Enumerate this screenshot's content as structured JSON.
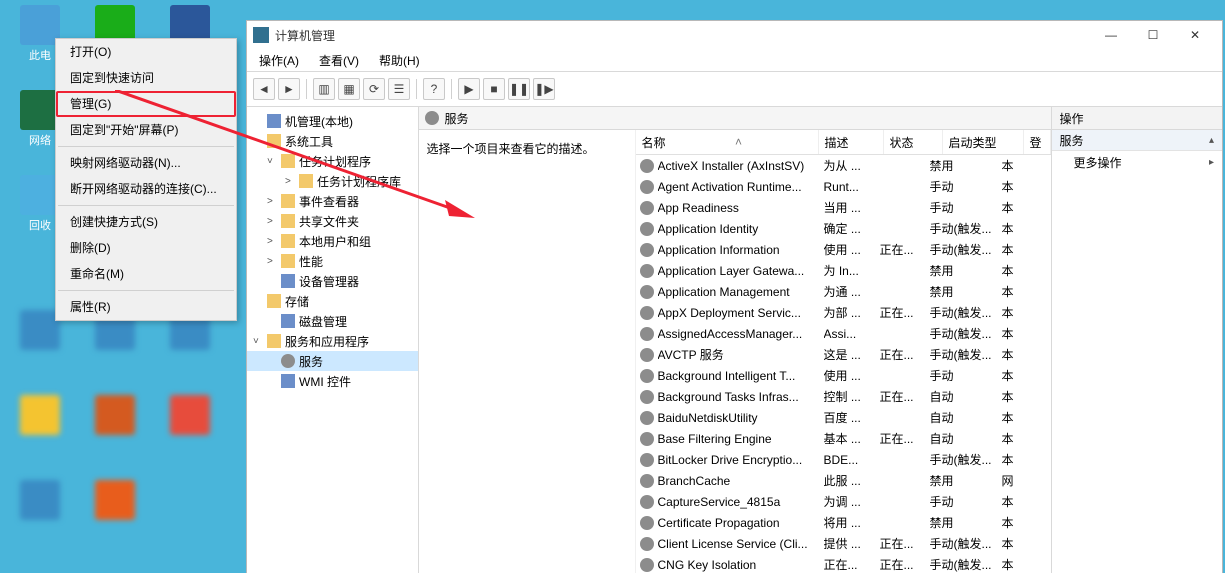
{
  "desktop": {
    "pc": "此电",
    "net": "网络",
    "bin": "回收"
  },
  "context_menu": {
    "open": "打开(O)",
    "pin_quick": "固定到快速访问",
    "manage": "管理(G)",
    "pin_start": "固定到\"开始\"屏幕(P)",
    "map_drive": "映射网络驱动器(N)...",
    "disconnect_drive": "断开网络驱动器的连接(C)...",
    "create_shortcut": "创建快捷方式(S)",
    "delete": "删除(D)",
    "rename": "重命名(M)",
    "properties": "属性(R)"
  },
  "window": {
    "title": "计算机管理",
    "min_glyph": "—",
    "max_glyph": "☐",
    "close_glyph": "✕"
  },
  "menubar": {
    "action": "操作(A)",
    "view": "查看(V)",
    "help": "帮助(H)"
  },
  "tree": {
    "root": "机管理(本地)",
    "sys_tools": "系统工具",
    "task_sched": "任务计划程序",
    "task_sched_lib": "任务计划程序库",
    "event_viewer": "事件查看器",
    "shared": "共享文件夹",
    "users": "本地用户和组",
    "perf": "性能",
    "devmgr": "设备管理器",
    "storage": "存储",
    "diskmgmt": "磁盘管理",
    "services_apps": "服务和应用程序",
    "services": "服务",
    "wmi": "WMI 控件"
  },
  "center": {
    "tab_label": "服务",
    "desc_prompt": "选择一个项目来查看它的描述。"
  },
  "columns": {
    "name": "名称",
    "desc": "描述",
    "status": "状态",
    "start": "启动类型",
    "logon": "登"
  },
  "sort_glyph": "˄",
  "services": [
    {
      "name": "ActiveX Installer (AxInstSV)",
      "desc": "为从 ...",
      "status": "",
      "start": "禁用",
      "logon": "本"
    },
    {
      "name": "Agent Activation Runtime...",
      "desc": "Runt...",
      "status": "",
      "start": "手动",
      "logon": "本"
    },
    {
      "name": "App Readiness",
      "desc": "当用 ...",
      "status": "",
      "start": "手动",
      "logon": "本"
    },
    {
      "name": "Application Identity",
      "desc": "确定 ...",
      "status": "",
      "start": "手动(触发...",
      "logon": "本"
    },
    {
      "name": "Application Information",
      "desc": "使用 ...",
      "status": "正在...",
      "start": "手动(触发...",
      "logon": "本"
    },
    {
      "name": "Application Layer Gatewa...",
      "desc": "为 In...",
      "status": "",
      "start": "禁用",
      "logon": "本"
    },
    {
      "name": "Application Management",
      "desc": "为通 ...",
      "status": "",
      "start": "禁用",
      "logon": "本"
    },
    {
      "name": "AppX Deployment Servic...",
      "desc": "为部 ...",
      "status": "正在...",
      "start": "手动(触发...",
      "logon": "本"
    },
    {
      "name": "AssignedAccessManager...",
      "desc": "Assi...",
      "status": "",
      "start": "手动(触发...",
      "logon": "本"
    },
    {
      "name": "AVCTP 服务",
      "desc": "这是 ...",
      "status": "正在...",
      "start": "手动(触发...",
      "logon": "本"
    },
    {
      "name": "Background Intelligent T...",
      "desc": "使用 ...",
      "status": "",
      "start": "手动",
      "logon": "本"
    },
    {
      "name": "Background Tasks Infras...",
      "desc": "控制 ...",
      "status": "正在...",
      "start": "自动",
      "logon": "本"
    },
    {
      "name": "BaiduNetdiskUtility",
      "desc": "百度 ...",
      "status": "",
      "start": "自动",
      "logon": "本"
    },
    {
      "name": "Base Filtering Engine",
      "desc": "基本 ...",
      "status": "正在...",
      "start": "自动",
      "logon": "本"
    },
    {
      "name": "BitLocker Drive Encryptio...",
      "desc": "BDE...",
      "status": "",
      "start": "手动(触发...",
      "logon": "本"
    },
    {
      "name": "BranchCache",
      "desc": "此服 ...",
      "status": "",
      "start": "禁用",
      "logon": "网"
    },
    {
      "name": "CaptureService_4815a",
      "desc": "为调 ...",
      "status": "",
      "start": "手动",
      "logon": "本"
    },
    {
      "name": "Certificate Propagation",
      "desc": "将用 ...",
      "status": "",
      "start": "禁用",
      "logon": "本"
    },
    {
      "name": "Client License Service (Cli...",
      "desc": "提供 ...",
      "status": "正在...",
      "start": "手动(触发...",
      "logon": "本"
    },
    {
      "name": "CNG Key Isolation",
      "desc": "正在...",
      "status": "正在...",
      "start": "手动(触发...",
      "logon": "本"
    }
  ],
  "actions": {
    "header": "操作",
    "section": "服务",
    "more": "更多操作"
  }
}
